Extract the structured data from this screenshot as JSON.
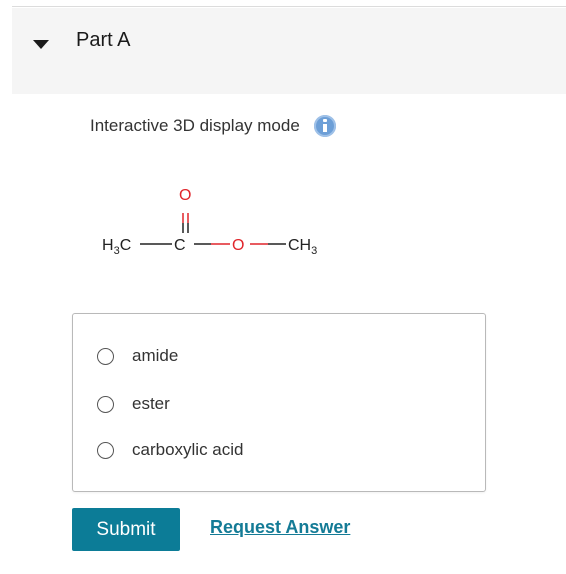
{
  "part": {
    "title": "Part A",
    "caret_icon": "caret-down-icon"
  },
  "display_mode": {
    "label": "Interactive 3D display mode",
    "icon": "info-icon",
    "icon_color": "#6d9fd7"
  },
  "molecule": {
    "left_group_main": "H",
    "left_group_sub": "3",
    "left_group_tail": "C",
    "carbonyl_carbon": "C",
    "carbonyl_oxygen": "O",
    "ether_oxygen": "O",
    "right_group_main": "CH",
    "right_group_sub": "3",
    "oxygen_color": "#e0252b"
  },
  "options": [
    {
      "label": "amide"
    },
    {
      "label": "ester"
    },
    {
      "label": "carboxylic acid"
    }
  ],
  "actions": {
    "submit_label": "Submit",
    "request_answer_label": "Request Answer"
  },
  "colors": {
    "submit_bg": "#0c7c97",
    "link": "#147b96"
  }
}
